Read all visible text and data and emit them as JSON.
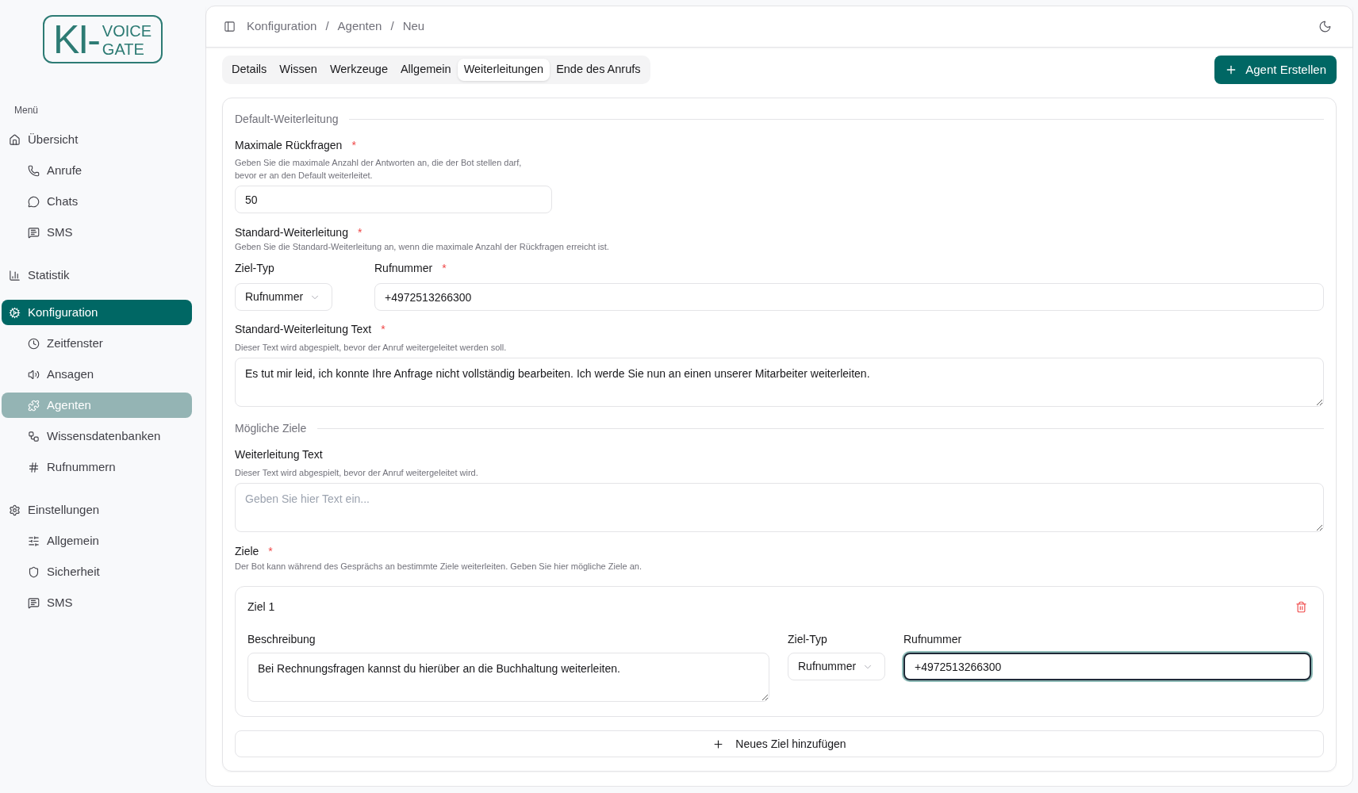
{
  "logo": {
    "big": "KI-",
    "top": "VOICE",
    "bottom": "GATE"
  },
  "sidebar": {
    "heading": "Menü",
    "groups": [
      {
        "label": "Übersicht",
        "selected": false,
        "children": [
          {
            "label": "Anrufe",
            "selected": false
          },
          {
            "label": "Chats",
            "selected": false
          },
          {
            "label": "SMS",
            "selected": false
          }
        ]
      },
      {
        "label": "Statistik",
        "selected": false
      },
      {
        "label": "Konfiguration",
        "selected": true,
        "children": [
          {
            "label": "Zeitfenster",
            "selected": false
          },
          {
            "label": "Ansagen",
            "selected": false
          },
          {
            "label": "Agenten",
            "selected": true
          },
          {
            "label": "Wissensdatenbanken",
            "selected": false
          },
          {
            "label": "Rufnummern",
            "selected": false
          }
        ]
      },
      {
        "label": "Einstellungen",
        "selected": false,
        "children": [
          {
            "label": "Allgemein",
            "selected": false
          },
          {
            "label": "Sicherheit",
            "selected": false
          },
          {
            "label": "SMS",
            "selected": false
          }
        ]
      }
    ]
  },
  "breadcrumb": {
    "separator": "/",
    "items": [
      "Konfiguration",
      "Agenten",
      "Neu"
    ]
  },
  "tabs": [
    {
      "label": "Details",
      "selected": false
    },
    {
      "label": "Wissen",
      "selected": false
    },
    {
      "label": "Werkzeuge",
      "selected": false
    },
    {
      "label": "Allgemein",
      "selected": false
    },
    {
      "label": "Weiterleitungen",
      "selected": true
    },
    {
      "label": "Ende des Anrufs",
      "selected": false
    }
  ],
  "primary_button": {
    "label": "Agent Erstellen"
  },
  "form": {
    "sections": [
      {
        "title": "Default-Weiterleitung",
        "fields": [
          {
            "kind": "input",
            "label": "Maximale Rückfragen",
            "required_mark": "*",
            "description": "Geben Sie die maximale Anzahl der Antworten an, die der Bot stellen darf,\nbevor er an den Default weiterleitet.",
            "value": "50"
          },
          {
            "kind": "forwarding",
            "label": "Standard-Weiterleitung",
            "required_mark": "*",
            "description": "Geben Sie die Standard-Weiterleitung an, wenn die maximale Anzahl der Rückfragen erreicht ist.",
            "target_type": {
              "label": "Ziel-Typ",
              "value": "Rufnummer"
            },
            "number": {
              "label": "Rufnummer",
              "required_mark": "*",
              "value": "+4972513266300",
              "focused": false
            }
          },
          {
            "kind": "textarea",
            "label": "Standard-Weiterleitung Text",
            "required_mark": "*",
            "description": "Dieser Text wird abgespielt, bevor der Anruf weitergeleitet werden soll.",
            "value": "Es tut mir leid, ich konnte Ihre Anfrage nicht vollständig bearbeiten. Ich werde Sie nun an einen unserer Mitarbeiter weiterleiten."
          }
        ]
      },
      {
        "title": "Mögliche Ziele",
        "fields": [
          {
            "kind": "textarea",
            "label": "Weiterleitung Text",
            "description": "Dieser Text wird abgespielt, bevor der Anruf weitergeleitet wird.",
            "placeholder": "Geben Sie hier Text ein..."
          },
          {
            "kind": "targets",
            "label": "Ziele",
            "required_mark": "*",
            "description": "Der Bot kann während des Gesprächs an bestimmte Ziele weiterleiten. Geben Sie hier mögliche Ziele an.",
            "items": [
              {
                "title": "Ziel 1",
                "description": {
                  "label": "Beschreibung",
                  "value": "Bei Rechnungsfragen kannst du hierüber an die Buchhaltung weiterleiten."
                },
                "target_type": {
                  "label": "Ziel-Typ",
                  "value": "Rufnummer"
                },
                "number": {
                  "label": "Rufnummer",
                  "value": "+4972513266300",
                  "focused": true
                }
              }
            ],
            "add_button": "Neues Ziel hinzufügen"
          }
        ]
      }
    ]
  }
}
